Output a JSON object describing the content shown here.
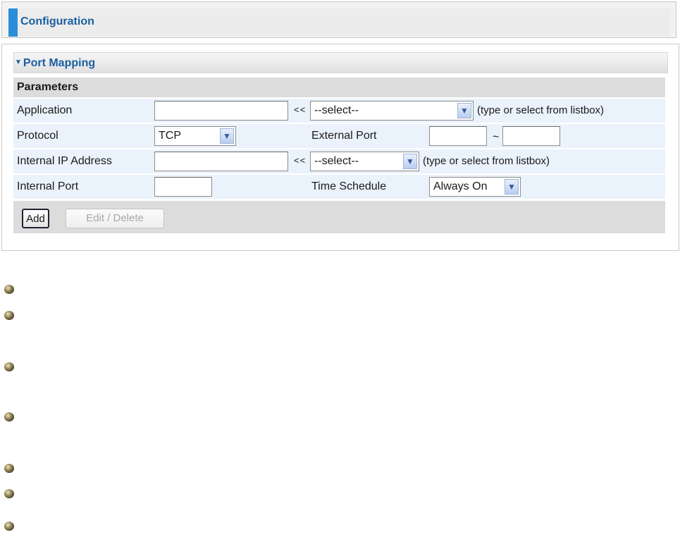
{
  "header": {
    "title": "Configuration"
  },
  "panel": {
    "title": "Port Mapping",
    "parameters_label": "Parameters",
    "rows": {
      "application": {
        "label": "Application",
        "value": "",
        "arrows": "<<",
        "select_value": "--select--",
        "note": "(type or select from listbox)"
      },
      "protocol": {
        "label": "Protocol",
        "select_value": "TCP",
        "external_port_label": "External Port",
        "port_start": "",
        "tilde": "~",
        "port_end": ""
      },
      "internal_ip": {
        "label": "Internal IP Address",
        "value": "",
        "arrows": "<<",
        "select_value": "--select--",
        "note": "(type or select from listbox)"
      },
      "internal_port": {
        "label": "Internal Port",
        "value": "",
        "schedule_label": "Time Schedule",
        "schedule_value": "Always On"
      }
    },
    "buttons": {
      "add": "Add",
      "edit_delete": "Edit / Delete"
    }
  },
  "bullets": 7,
  "icons": {
    "panel_toggle": "triangle-down-icon",
    "dropdown": "chevron-down-icon",
    "bullet": "bullet-icon"
  },
  "colors": {
    "accent_bar": "#2a8fd8",
    "title_text": "#1a5fa0",
    "row_bg": "#eaf2fb"
  }
}
